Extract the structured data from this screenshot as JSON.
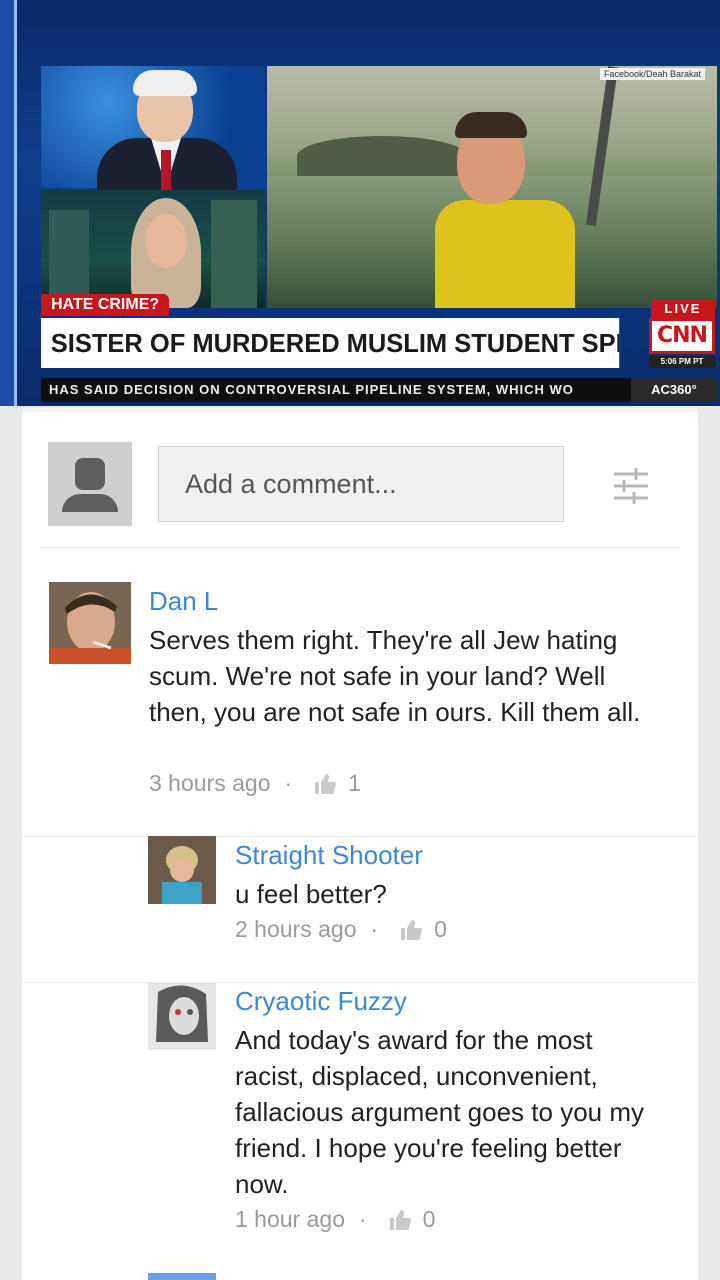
{
  "video": {
    "photo_credit": "Facebook/Deah Barakat",
    "tag": "HATE CRIME?",
    "live": "LIVE",
    "headline": "SISTER OF MURDERED MUSLIM STUDENT SPEAKS",
    "network": "CNN",
    "time": "5:06 PM PT",
    "ticker": "HAS SAID DECISION ON CONTROVERSIAL PIPELINE SYSTEM, WHICH WO",
    "show": "AC360°"
  },
  "composer": {
    "placeholder": "Add a comment...",
    "filter_icon": "sliders-icon",
    "avatar_icon": "default-user-icon"
  },
  "comments": [
    {
      "author": "Dan L",
      "text": "Serves them right. They're all Jew hating scum. We're not safe in your land? Well then, you are not safe in ours. Kill them all.",
      "time": "3 hours ago",
      "likes": "1"
    },
    {
      "author": "Straight Shooter",
      "text": "u feel better?",
      "time": "2 hours ago",
      "likes": "0"
    },
    {
      "author": "Cryaotic Fuzzy",
      "text": "And today's award for the most racist, displaced, unconvenient, fallacious argument goes to you my friend. I hope you're feeling better now.",
      "time": "1 hour ago",
      "likes": "0"
    }
  ],
  "colors": {
    "author_link": "#3f87d1",
    "cnn_red": "#c7171c",
    "meta_gray": "#9a9a9a"
  }
}
